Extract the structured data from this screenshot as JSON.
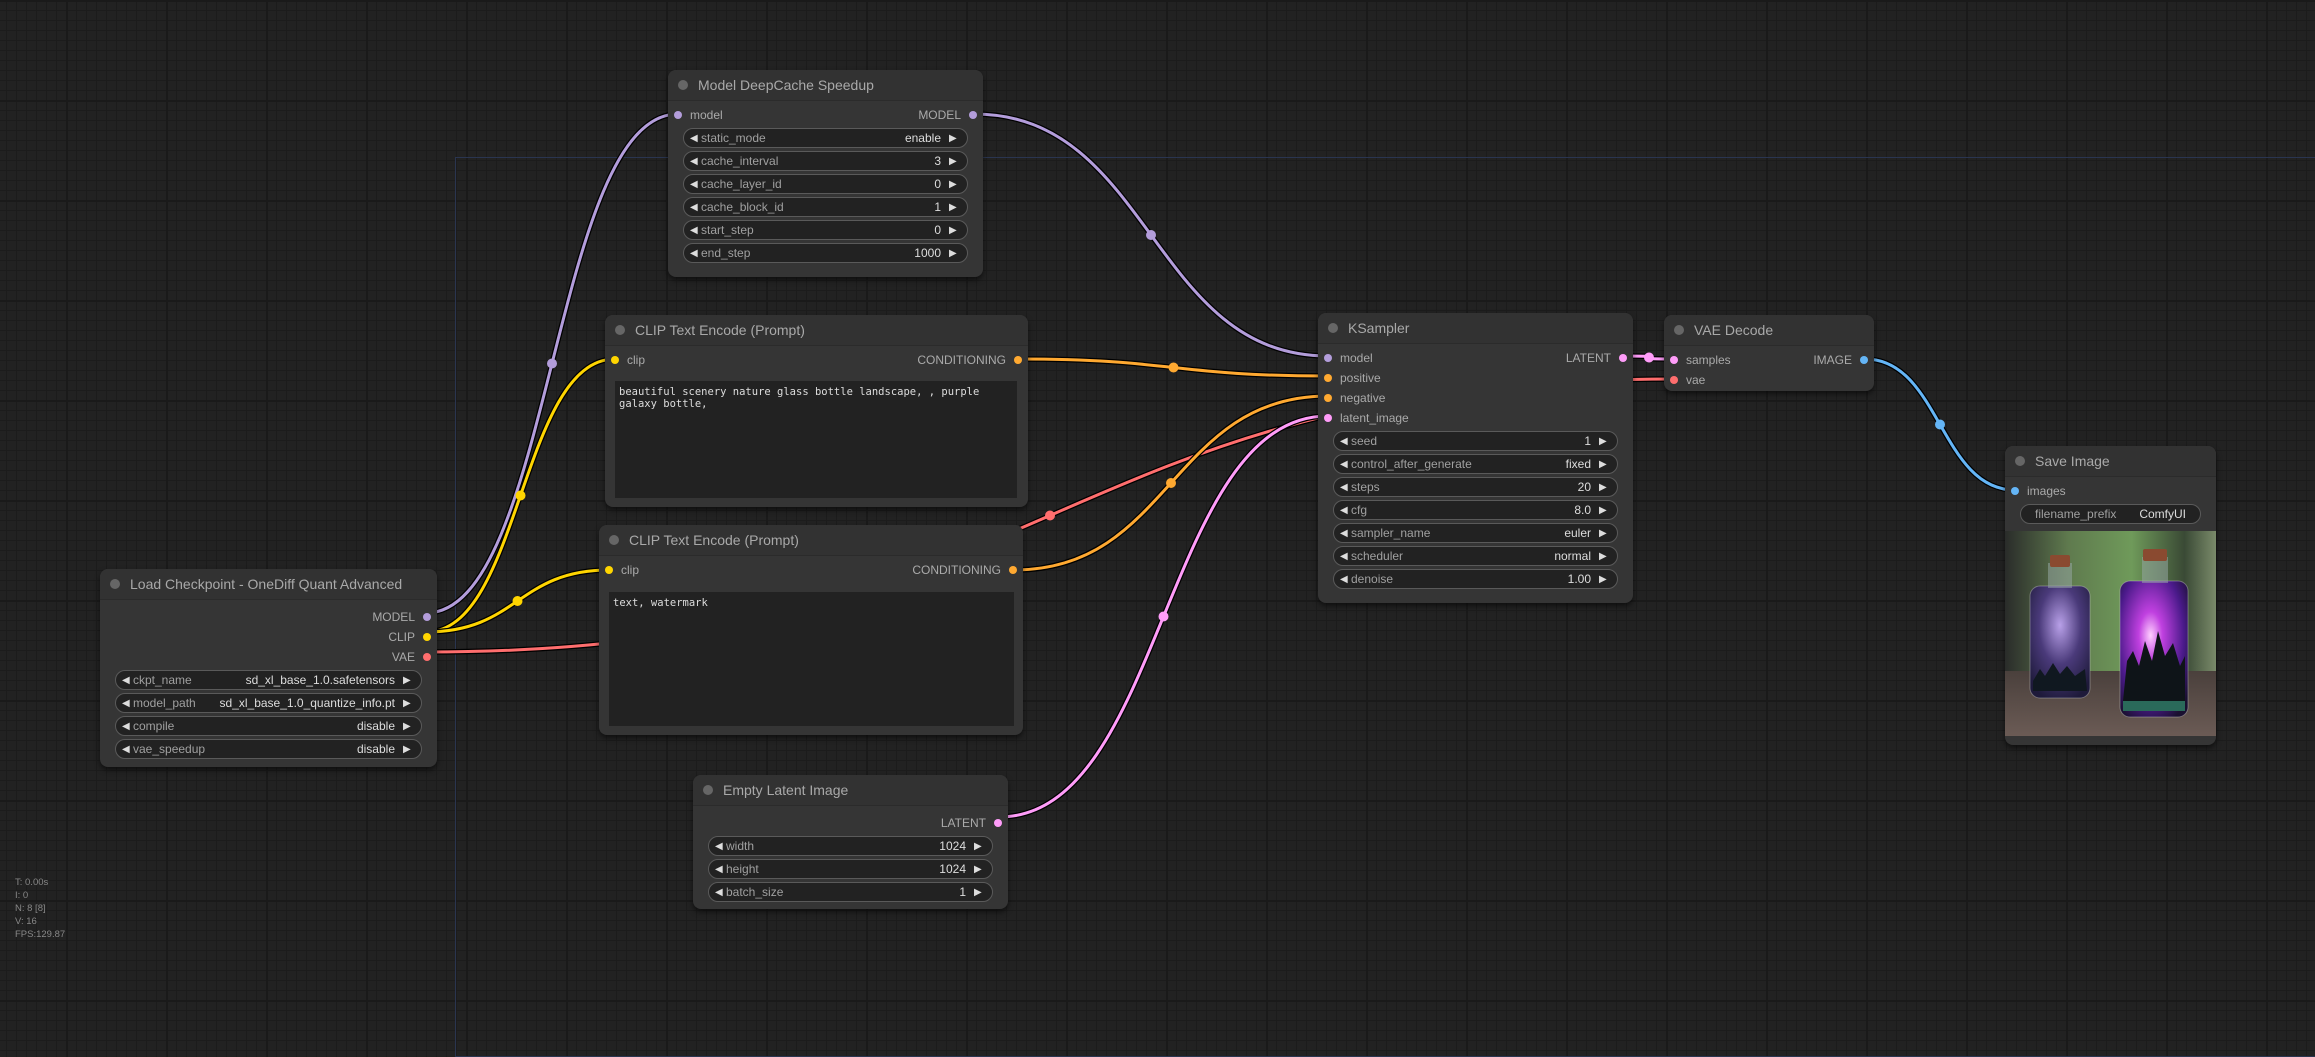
{
  "colors": {
    "model": "#b39ddb",
    "clip": "#ffd500",
    "vae": "#ff6e6e",
    "conditioning": "#ffa931",
    "latent": "#ff9cf9",
    "image": "#64b5f6"
  },
  "nodes": {
    "deepcache": {
      "title": "Model DeepCache Speedup",
      "input": "model",
      "output": "MODEL",
      "widgets": [
        {
          "name": "static_mode",
          "value": "enable"
        },
        {
          "name": "cache_interval",
          "value": "3"
        },
        {
          "name": "cache_layer_id",
          "value": "0"
        },
        {
          "name": "cache_block_id",
          "value": "1"
        },
        {
          "name": "start_step",
          "value": "0"
        },
        {
          "name": "end_step",
          "value": "1000"
        }
      ]
    },
    "clip_pos": {
      "title": "CLIP Text Encode (Prompt)",
      "input": "clip",
      "output": "CONDITIONING",
      "text": "beautiful scenery nature glass bottle landscape, , purple galaxy bottle,"
    },
    "clip_neg": {
      "title": "CLIP Text Encode (Prompt)",
      "input": "clip",
      "output": "CONDITIONING",
      "text": "text, watermark"
    },
    "checkpoint": {
      "title": "Load Checkpoint - OneDiff Quant Advanced",
      "outputs": [
        "MODEL",
        "CLIP",
        "VAE"
      ],
      "widgets": [
        {
          "name": "ckpt_name",
          "value": "sd_xl_base_1.0.safetensors"
        },
        {
          "name": "model_path",
          "value": "sd_xl_base_1.0_quantize_info.pt"
        },
        {
          "name": "compile",
          "value": "disable"
        },
        {
          "name": "vae_speedup",
          "value": "disable"
        }
      ]
    },
    "ksampler": {
      "title": "KSampler",
      "inputs": [
        "model",
        "positive",
        "negative",
        "latent_image"
      ],
      "output": "LATENT",
      "widgets": [
        {
          "name": "seed",
          "value": "1"
        },
        {
          "name": "control_after_generate",
          "value": "fixed"
        },
        {
          "name": "steps",
          "value": "20"
        },
        {
          "name": "cfg",
          "value": "8.0"
        },
        {
          "name": "sampler_name",
          "value": "euler"
        },
        {
          "name": "scheduler",
          "value": "normal"
        },
        {
          "name": "denoise",
          "value": "1.00"
        }
      ]
    },
    "vae_decode": {
      "title": "VAE Decode",
      "inputs": [
        "samples",
        "vae"
      ],
      "output": "IMAGE"
    },
    "save_image": {
      "title": "Save Image",
      "input": "images",
      "widget": {
        "name": "filename_prefix",
        "value": "ComfyUI"
      },
      "preview_alt": "two glass bottles with purple galaxy and forest scenery"
    },
    "empty_latent": {
      "title": "Empty Latent Image",
      "output": "LATENT",
      "widgets": [
        {
          "name": "width",
          "value": "1024"
        },
        {
          "name": "height",
          "value": "1024"
        },
        {
          "name": "batch_size",
          "value": "1"
        }
      ]
    }
  },
  "stats": {
    "t": "T: 0.00s",
    "i": "I: 0",
    "n": "N: 8 [8]",
    "v": "V: 16",
    "fps": "FPS:129.87"
  }
}
